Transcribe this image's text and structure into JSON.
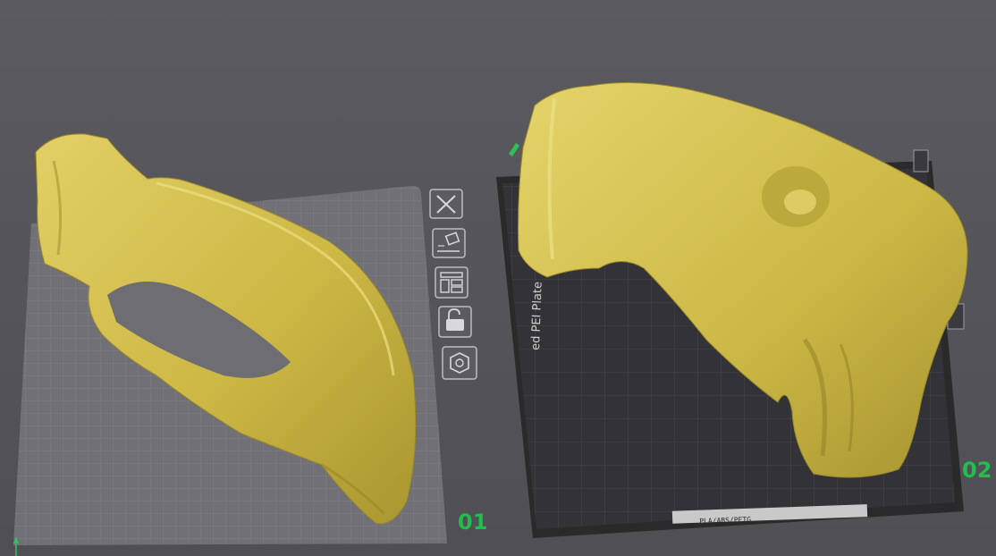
{
  "viewport": {
    "background": "#56565b",
    "model_color": "#d7c451"
  },
  "plates": [
    {
      "label": "01",
      "type": "empty-grid-plate"
    },
    {
      "label": "02",
      "type": "textured-pei-plate",
      "side_text": "ed PEI Plate",
      "strip_text": "PLA/ABS/PETG"
    }
  ],
  "plate_toolbar": [
    {
      "name": "remove-plate",
      "icon": "close-icon"
    },
    {
      "name": "auto-orient",
      "icon": "auto-orient-icon"
    },
    {
      "name": "arrange",
      "icon": "arrange-icon"
    },
    {
      "name": "lock-plate",
      "icon": "unlock-icon"
    },
    {
      "name": "plate-settings",
      "icon": "hexagon-nut-icon"
    }
  ],
  "accent_colors": {
    "plate_label": "#1fbf4f",
    "plate_text": "#cfcfcf"
  }
}
